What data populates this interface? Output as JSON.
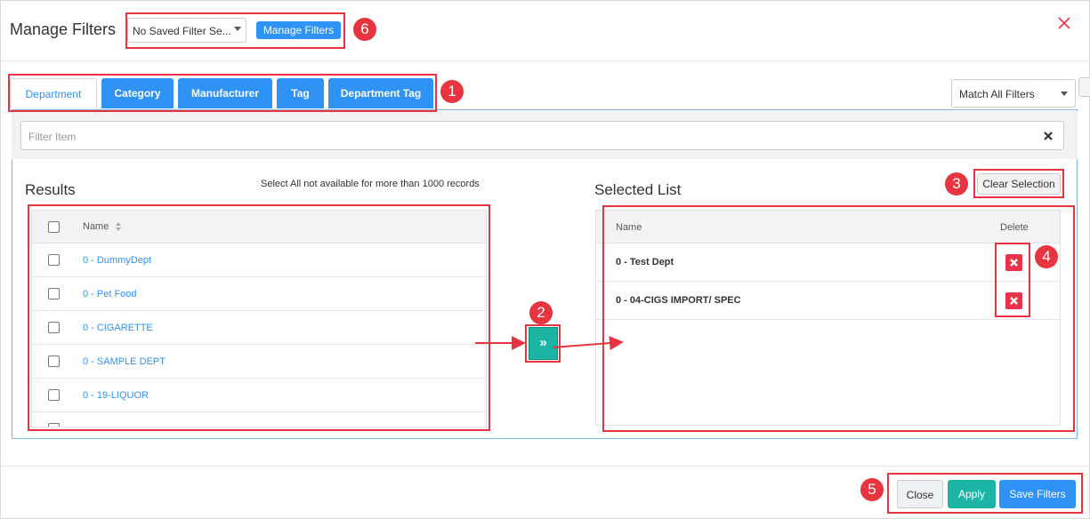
{
  "header": {
    "title": "Manage Filters",
    "saved_filter_value": "No Saved Filter Se...",
    "manage_button_label": "Manage Filters"
  },
  "tabs": [
    {
      "label": "Department",
      "active": true
    },
    {
      "label": "Category"
    },
    {
      "label": "Manufacturer"
    },
    {
      "label": "Tag"
    },
    {
      "label": "Department Tag"
    }
  ],
  "match_select_value": "Match All Filters",
  "filter_input_placeholder": "Filter Item",
  "results": {
    "title": "Results",
    "note": "Select All not available for more than 1000 records",
    "column_name": "Name",
    "rows": [
      "0 - DummyDept",
      "0 - Pet Food",
      "0 - CIGARETTE",
      "0 - SAMPLE DEPT",
      "0 - 19-LIQUOR"
    ]
  },
  "selected": {
    "title": "Selected List",
    "clear_label": "Clear Selection",
    "column_name": "Name",
    "column_delete": "Delete",
    "rows": [
      "0 - Test Dept",
      "0 - 04-CIGS IMPORT/ SPEC"
    ]
  },
  "move_button_glyph": "»",
  "footer": {
    "close_label": "Close",
    "apply_label": "Apply",
    "save_label": "Save Filters"
  },
  "annotations": [
    "1",
    "2",
    "3",
    "4",
    "5",
    "6"
  ],
  "colors": {
    "primary": "#2f92f5",
    "teal": "#1cb5a5",
    "delete": "#e8334a",
    "annotation": "#e8343e"
  }
}
